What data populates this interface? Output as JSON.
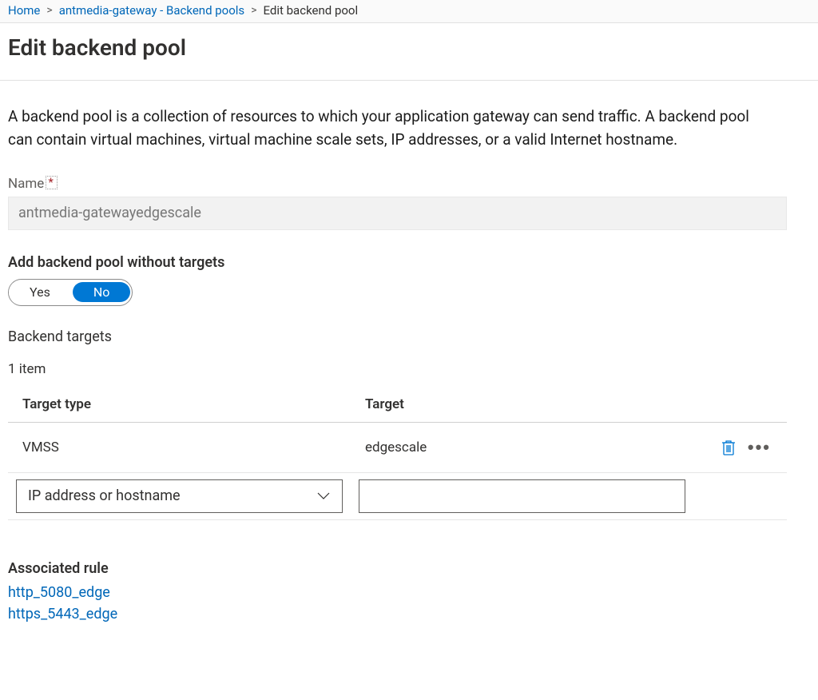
{
  "breadcrumb": {
    "home": "Home",
    "parent": "antmedia-gateway - Backend pools",
    "current": "Edit backend pool"
  },
  "page_title": "Edit backend pool",
  "description": "A backend pool is a collection of resources to which your application gateway can send traffic. A backend pool can contain virtual machines, virtual machine scale sets, IP addresses, or a valid Internet hostname.",
  "name_field": {
    "label": "Name",
    "value": "antmedia-gatewayedgescale"
  },
  "without_targets": {
    "label": "Add backend pool without targets",
    "yes": "Yes",
    "no": "No",
    "selected": "No"
  },
  "targets": {
    "heading": "Backend targets",
    "count_label": "1 item",
    "col_type": "Target type",
    "col_target": "Target",
    "rows": [
      {
        "type": "VMSS",
        "target": "edgescale"
      }
    ],
    "new_row": {
      "type_selected": "IP address or hostname",
      "target_value": ""
    }
  },
  "associated_rule": {
    "heading": "Associated rule",
    "links": [
      "http_5080_edge",
      "https_5443_edge"
    ]
  }
}
